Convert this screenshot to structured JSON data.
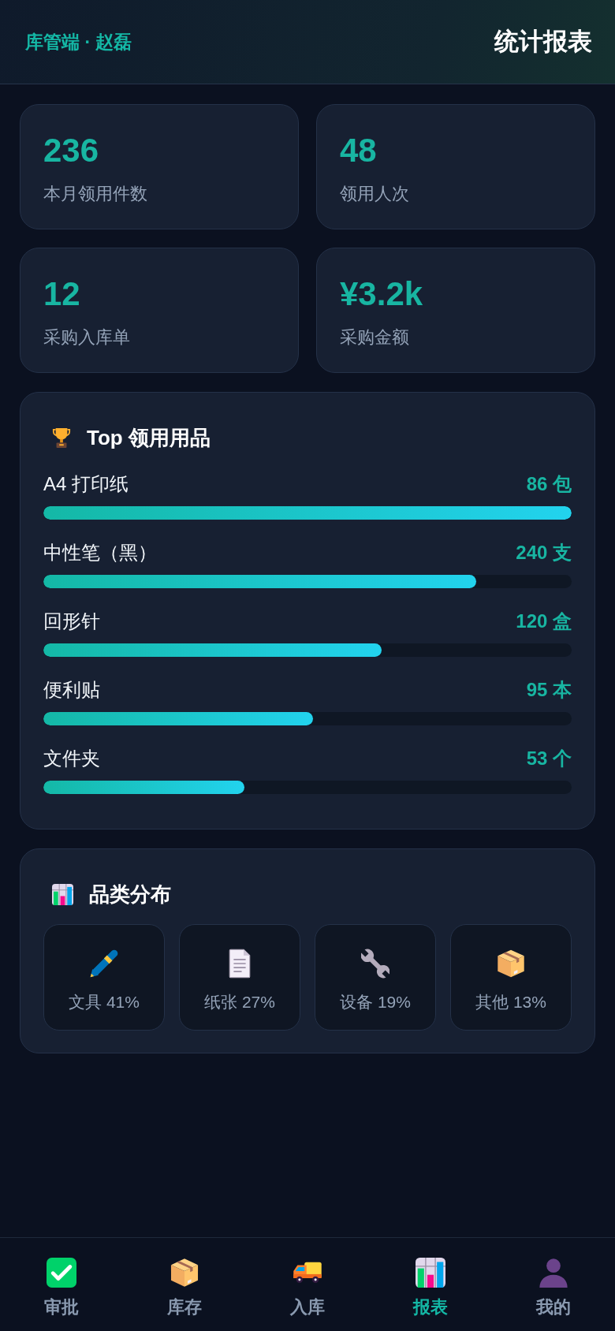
{
  "header": {
    "subtitle": "库管端 · 赵磊",
    "title": "统计报表"
  },
  "stats": [
    {
      "value": "236",
      "label": "本月领用件数"
    },
    {
      "value": "48",
      "label": "领用人次"
    },
    {
      "value": "12",
      "label": "采购入库单"
    },
    {
      "value": "¥3.2k",
      "label": "采购金额"
    }
  ],
  "top_items": {
    "title": "Top 领用用品",
    "items": [
      {
        "name": "A4 打印纸",
        "amount": "86 包",
        "level": 1.0
      },
      {
        "name": "中性笔（黑）",
        "amount": "240 支",
        "level": 0.82
      },
      {
        "name": "回形针",
        "amount": "120 盒",
        "level": 0.64
      },
      {
        "name": "便利贴",
        "amount": "95 本",
        "level": 0.51
      },
      {
        "name": "文件夹",
        "amount": "53 个",
        "level": 0.38
      }
    ]
  },
  "categories": {
    "title": "品类分布",
    "items": [
      {
        "label": "文具 41%"
      },
      {
        "label": "纸张 27%"
      },
      {
        "label": "设备 19%"
      },
      {
        "label": "其他 13%"
      }
    ]
  },
  "nav": [
    {
      "label": "审批",
      "selected": false
    },
    {
      "label": "库存",
      "selected": false
    },
    {
      "label": "入库",
      "selected": false
    },
    {
      "label": "报表",
      "selected": true
    },
    {
      "label": "我的",
      "selected": false
    }
  ]
}
